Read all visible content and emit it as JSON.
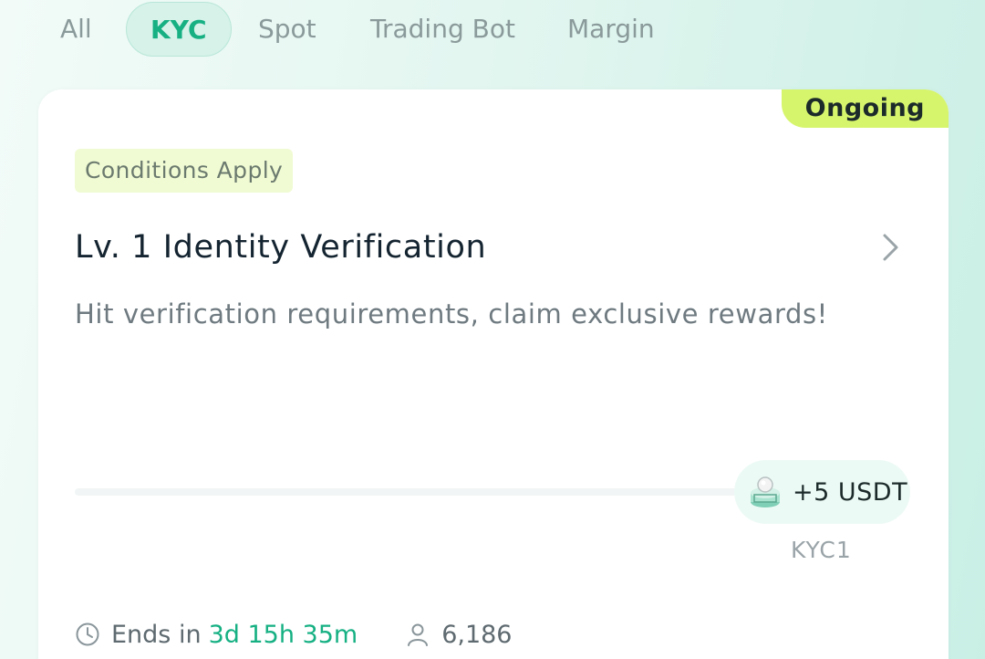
{
  "tabs": [
    {
      "label": "All",
      "active": false
    },
    {
      "label": "KYC",
      "active": true
    },
    {
      "label": "Spot",
      "active": false
    },
    {
      "label": "Trading Bot",
      "active": false
    },
    {
      "label": "Margin",
      "active": false
    }
  ],
  "card": {
    "status": "Ongoing",
    "tag": "Conditions Apply",
    "title": "Lv. 1 Identity Verification",
    "description": "Hit verification requirements, claim exclusive rewards!",
    "progress_fraction": 0,
    "reward": {
      "amount": "+5 USDT",
      "code": "KYC1",
      "icon": "coin-stack-icon"
    },
    "ends_label": "Ends in",
    "countdown": "3d 15h 35m",
    "participants": "6,186"
  },
  "colors": {
    "accent": "#16b083",
    "status_badge": "#d6f56c",
    "tag_bg": "#f0fbd3",
    "title": "#142430"
  }
}
